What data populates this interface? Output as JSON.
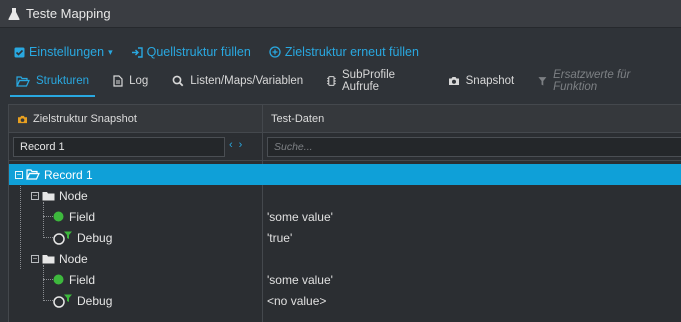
{
  "window": {
    "title": "Teste Mapping"
  },
  "toolbar": {
    "einstellungen": "Einstellungen",
    "quellstruktur": "Quellstruktur füllen",
    "zielstruktur": "Zielstruktur erneut füllen"
  },
  "tabs": [
    {
      "label": "Strukturen",
      "icon": "folder-open-icon",
      "active": true
    },
    {
      "label": "Log",
      "icon": "document-icon"
    },
    {
      "label": "Listen/Maps/Variablen",
      "icon": "search-icon"
    },
    {
      "label": "SubProfile Aufrufe",
      "icon": "chip-icon"
    },
    {
      "label": "Snapshot",
      "icon": "camera-icon"
    },
    {
      "label": "Ersatzwerte für Funktion",
      "icon": "filter-icon",
      "disabled": true
    }
  ],
  "grid": {
    "col_left": "Zielstruktur Snapshot",
    "col_right": "Test-Daten",
    "record_select": "Record 1",
    "search_placeholder": "Suche...",
    "rows": [
      {
        "label": "Record 1",
        "value": ""
      },
      {
        "label": "Node",
        "value": ""
      },
      {
        "label": "Field",
        "value": "'some value'"
      },
      {
        "label": "Debug",
        "value": "'true'"
      },
      {
        "label": "Node",
        "value": ""
      },
      {
        "label": "Field",
        "value": "'some value'"
      },
      {
        "label": "Debug",
        "value": "<no value>"
      }
    ]
  },
  "colors": {
    "accent": "#29a8e0",
    "selected": "#0fa0d8",
    "field": "#3db83d",
    "snapshot": "#e8a020"
  }
}
